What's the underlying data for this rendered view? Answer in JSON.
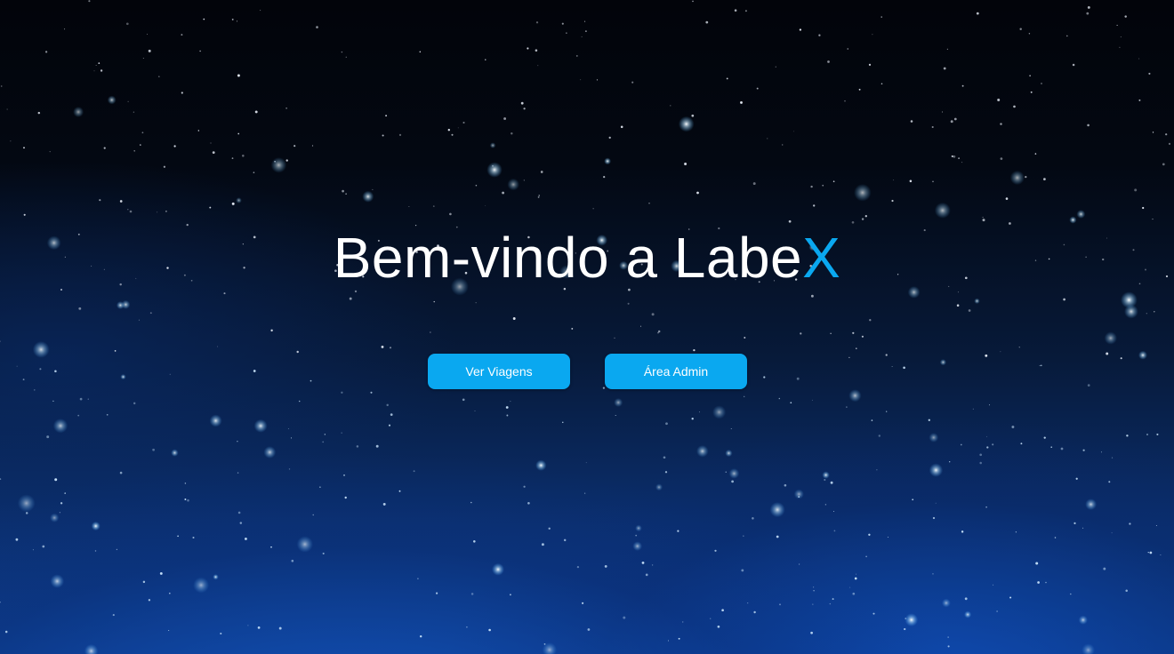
{
  "hero": {
    "title_main": "Bem-vindo a Labe",
    "title_accent": "X"
  },
  "actions": {
    "trips_label": "Ver Viagens",
    "admin_label": "Área Admin"
  },
  "colors": {
    "accent": "#0aa8f0",
    "text": "#ffffff",
    "background_top": "#02040a",
    "background_bottom": "#0d3c8c"
  }
}
